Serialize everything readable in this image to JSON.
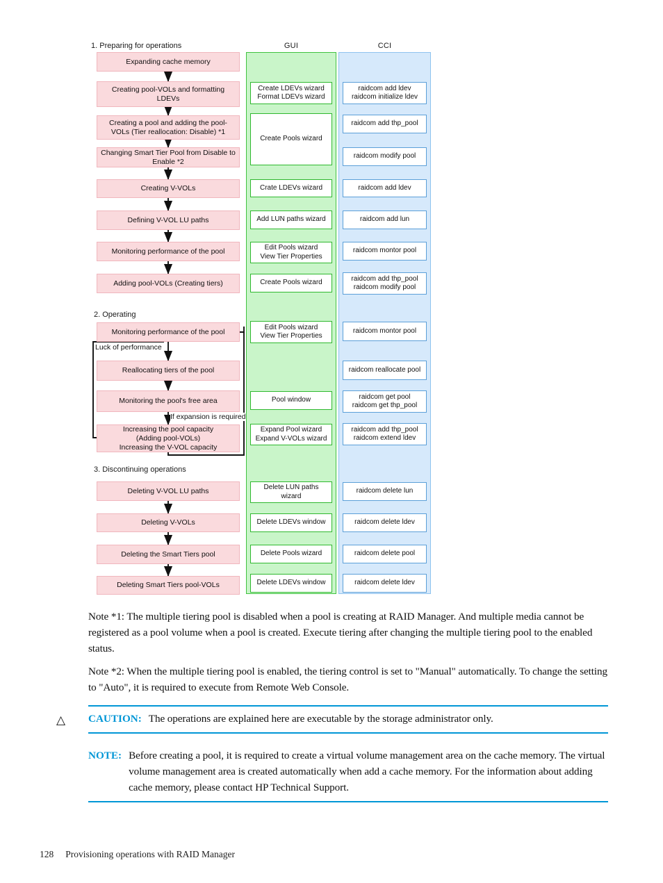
{
  "diagram": {
    "column_headers": {
      "gui": "GUI",
      "cci": "CCI"
    },
    "sections": [
      {
        "id": "s1",
        "label": "1. Preparing for operations"
      },
      {
        "id": "s2",
        "label": "2. Operating"
      },
      {
        "id": "s3",
        "label": "3. Discontinuing operations"
      }
    ],
    "arrow_labels": {
      "luck": "Luck of performance",
      "expansion": "If expansion is required"
    },
    "flow_steps": [
      {
        "id": "f1",
        "text": "Expanding cache memory"
      },
      {
        "id": "f2",
        "text": "Creating pool-VOLs and formatting LDEVs"
      },
      {
        "id": "f3",
        "text": "Creating a pool and adding the pool-VOLs (Tier reallocation: Disable) *1"
      },
      {
        "id": "f4",
        "text": "Changing Smart Tier Pool from Disable to Enable *2"
      },
      {
        "id": "f5",
        "text": "Creating V-VOLs"
      },
      {
        "id": "f6",
        "text": "Defining V-VOL LU paths"
      },
      {
        "id": "f7",
        "text": "Monitoring performance of the pool"
      },
      {
        "id": "f8",
        "text": "Adding pool-VOLs (Creating tiers)"
      },
      {
        "id": "f9",
        "text": "Monitoring performance of the pool"
      },
      {
        "id": "f10",
        "text": "Reallocating tiers of the pool"
      },
      {
        "id": "f11",
        "text": "Monitoring the pool's free area"
      },
      {
        "id": "f12",
        "text": "Increasing the pool capacity\n(Adding pool-VOLs)\nIncreasing the V-VOL capacity"
      },
      {
        "id": "f13",
        "text": "Deleting V-VOL LU paths"
      },
      {
        "id": "f14",
        "text": "Deleting V-VOLs"
      },
      {
        "id": "f15",
        "text": "Deleting the Smart Tiers pool"
      },
      {
        "id": "f16",
        "text": "Deleting Smart Tiers pool-VOLs"
      }
    ],
    "gui_items": [
      {
        "id": "g1",
        "text": "Create LDEVs wizard\nFormat LDEVs wizard"
      },
      {
        "id": "g2",
        "text": "Create Pools wizard"
      },
      {
        "id": "g3",
        "text": "Crate LDEVs wizard"
      },
      {
        "id": "g4",
        "text": "Add LUN paths wizard"
      },
      {
        "id": "g5",
        "text": "Edit Pools wizard\nView Tier Properties"
      },
      {
        "id": "g6",
        "text": "Create Pools wizard"
      },
      {
        "id": "g7",
        "text": "Edit Pools wizard\nView Tier Properties"
      },
      {
        "id": "g8",
        "text": "Pool window"
      },
      {
        "id": "g9",
        "text": "Expand Pool wizard\nExpand V-VOLs wizard"
      },
      {
        "id": "g10",
        "text": "Delete LUN paths\nwizard"
      },
      {
        "id": "g11",
        "text": "Delete LDEVs window"
      },
      {
        "id": "g12",
        "text": "Delete Pools wizard"
      },
      {
        "id": "g13",
        "text": "Delete LDEVs window"
      }
    ],
    "cci_items": [
      {
        "id": "c1",
        "text": "raidcom add ldev\nraidcom initialize ldev"
      },
      {
        "id": "c2",
        "text": "raidcom add thp_pool"
      },
      {
        "id": "c3",
        "text": "raidcom modify pool"
      },
      {
        "id": "c4",
        "text": "raidcom add ldev"
      },
      {
        "id": "c5",
        "text": "raidcom add lun"
      },
      {
        "id": "c6",
        "text": "raidcom montor pool"
      },
      {
        "id": "c7",
        "text": "raidcom add thp_pool\nraidcom modify pool"
      },
      {
        "id": "c8",
        "text": "raidcom montor pool"
      },
      {
        "id": "c9",
        "text": "raidcom reallocate pool"
      },
      {
        "id": "c10",
        "text": "raidcom get pool\nraidcom get thp_pool"
      },
      {
        "id": "c11",
        "text": "raidcom add thp_pool\nraidcom extend ldev"
      },
      {
        "id": "c12",
        "text": "raidcom delete lun"
      },
      {
        "id": "c13",
        "text": "raidcom delete ldev"
      },
      {
        "id": "c14",
        "text": "raidcom delete pool"
      },
      {
        "id": "c15",
        "text": "raidcom delete ldev"
      }
    ],
    "colors": {
      "flow_fill": "#fadadd",
      "flow_border": "#f0b6bd",
      "gui_band": "#c9f5c9",
      "gui_border": "#3fc23f",
      "cci_band": "#d6e9fb",
      "cci_border": "#8fc3ef"
    }
  },
  "notes": {
    "note1": "Note *1: The multiple tiering pool is disabled when a pool is creating at RAID Manager. And multiple media cannot be registered as a pool volume when a pool is created. Execute tiering after changing the multiple tiering pool to the enabled status.",
    "note2": "Note *2: When the multiple tiering pool is enabled, the tiering control is set to \"Manual\" automatically. To change the setting to \"Auto\", it is required to execute from Remote Web Console."
  },
  "admonitions": {
    "caution": {
      "icon": "△",
      "keyword": "CAUTION:",
      "text": "The operations are explained here are executable by the storage administrator only.",
      "accent": "#0096d6"
    },
    "note": {
      "keyword": "NOTE:",
      "text": "Before creating a pool, it is required to create a virtual volume management area on the cache memory. The virtual volume management area is created automatically when add a cache memory. For the information about adding cache memory, please contact HP Technical Support.",
      "accent": "#0096d6"
    }
  },
  "footer": {
    "page_number": "128",
    "chapter_title": "Provisioning operations with RAID Manager"
  }
}
